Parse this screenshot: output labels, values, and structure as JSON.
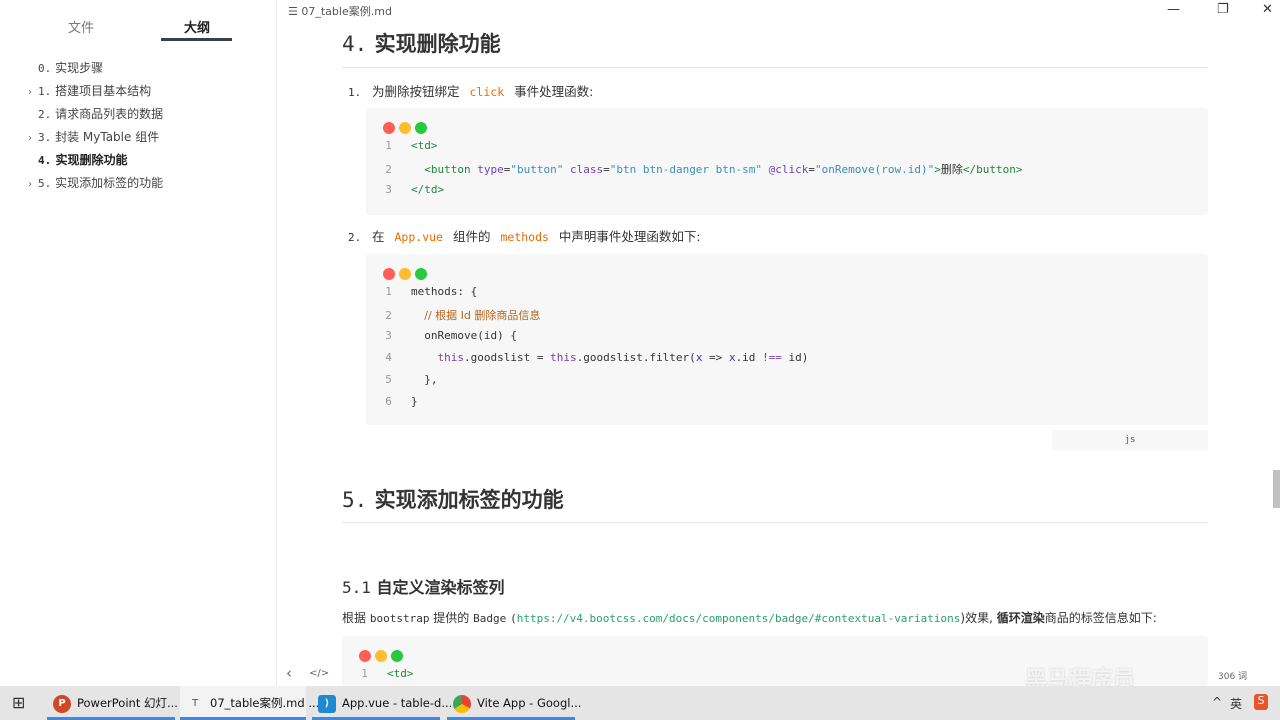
{
  "sidebar": {
    "tabs": [
      {
        "label": "文件"
      },
      {
        "label": "大纲"
      }
    ],
    "outline": [
      {
        "num": "0.",
        "label": "实现步骤",
        "expandable": false,
        "active": false
      },
      {
        "num": "1.",
        "label": "搭建项目基本结构",
        "expandable": true,
        "active": false
      },
      {
        "num": "2.",
        "label": "请求商品列表的数据",
        "expandable": false,
        "active": false
      },
      {
        "num": "3.",
        "label": "封装 MyTable 组件",
        "expandable": true,
        "active": false
      },
      {
        "num": "4.",
        "label": "实现删除功能",
        "expandable": false,
        "active": true
      },
      {
        "num": "5.",
        "label": "实现添加标签的功能",
        "expandable": true,
        "active": false
      }
    ]
  },
  "titlebar": {
    "filename": "07_table案例.md",
    "minimize": "—",
    "maximize": "❐",
    "close": "✕"
  },
  "doc": {
    "h2_4": {
      "num": "4.",
      "text": "实现删除功能"
    },
    "step1": {
      "num": "1.",
      "pre": "为删除按钮绑定",
      "code": "click",
      "post": "事件处理函数:"
    },
    "code1": [
      [
        [
          "tag",
          "<td>"
        ]
      ],
      [
        [
          "pl",
          "  "
        ],
        [
          "tag",
          "<button "
        ],
        [
          "attr",
          "type"
        ],
        [
          "pl",
          "="
        ],
        [
          "str",
          "\"button\""
        ],
        [
          "pl",
          " "
        ],
        [
          "attr",
          "class"
        ],
        [
          "pl",
          "="
        ],
        [
          "str",
          "\"btn btn-danger btn-sm\""
        ],
        [
          "pl",
          " "
        ],
        [
          "attr",
          "@click"
        ],
        [
          "pl",
          "="
        ],
        [
          "str",
          "\"onRemove(row.id)\""
        ],
        [
          "tag",
          ">"
        ],
        [
          "txt",
          "删除"
        ],
        [
          "tag",
          "</button>"
        ]
      ],
      [
        [
          "tag",
          "</td>"
        ]
      ]
    ],
    "step2": {
      "num": "2.",
      "pre": "在",
      "code1": "App.vue",
      "mid": "组件的",
      "code2": "methods",
      "post": "中声明事件处理函数如下:"
    },
    "code2": [
      [
        [
          "pl",
          "methods: {"
        ]
      ],
      [
        [
          "pl",
          "  "
        ],
        [
          "cm",
          "// 根据 Id 删除商品信息"
        ]
      ],
      [
        [
          "pl",
          "  onRemove(id) {"
        ]
      ],
      [
        [
          "pl",
          "    "
        ],
        [
          "this",
          "this"
        ],
        [
          "pl",
          ".goodslist = "
        ],
        [
          "this",
          "this"
        ],
        [
          "pl",
          ".goodslist.filter("
        ],
        [
          "var",
          "x"
        ],
        [
          "pl",
          " => "
        ],
        [
          "var",
          "x"
        ],
        [
          "pl",
          ".id "
        ],
        [
          "this",
          "!=="
        ],
        [
          "pl",
          " id)"
        ]
      ],
      [
        [
          "pl",
          "  },"
        ]
      ],
      [
        [
          "pl",
          "}"
        ]
      ]
    ],
    "code2_lang": "js",
    "h2_5": {
      "num": "5.",
      "text": "实现添加标签的功能"
    },
    "h3_51": {
      "num": "5.1",
      "text": "自定义渲染标签列"
    },
    "para": {
      "a": "根据",
      "b": "bootstrap",
      "c": "提供的",
      "d": "Badge",
      "e": "(",
      "link": "https://v4.bootcss.com/docs/components/badge/#contextual-variations",
      "f": ")效果,",
      "bold": "循环渲染",
      "g": "商品的标签信息如下:"
    },
    "code3": [
      [
        [
          "tag",
          "<td>"
        ]
      ]
    ]
  },
  "footer": {
    "back": "‹",
    "source": "</>",
    "word_count": "306 词"
  },
  "watermark": "黑马程序员",
  "taskbar": {
    "items": [
      {
        "label": "PowerPoint 幻灯...",
        "icon": "P",
        "color": "#d24726"
      },
      {
        "label": "07_table案例.md ...",
        "icon": "T",
        "color": "#f3f3f3"
      },
      {
        "label": "App.vue - table-d...",
        "icon": "⟩",
        "color": "#1f8ad2"
      },
      {
        "label": "Vite App - Googl...",
        "icon": "●",
        "color": "#4caf50"
      }
    ],
    "tray": {
      "chevron": "^",
      "ime": "英",
      "app": "S"
    }
  },
  "colors": {
    "red": "#ff5f56",
    "yellow": "#ffbd2e",
    "green": "#27c93f",
    "accent": "#3f8ae0"
  }
}
